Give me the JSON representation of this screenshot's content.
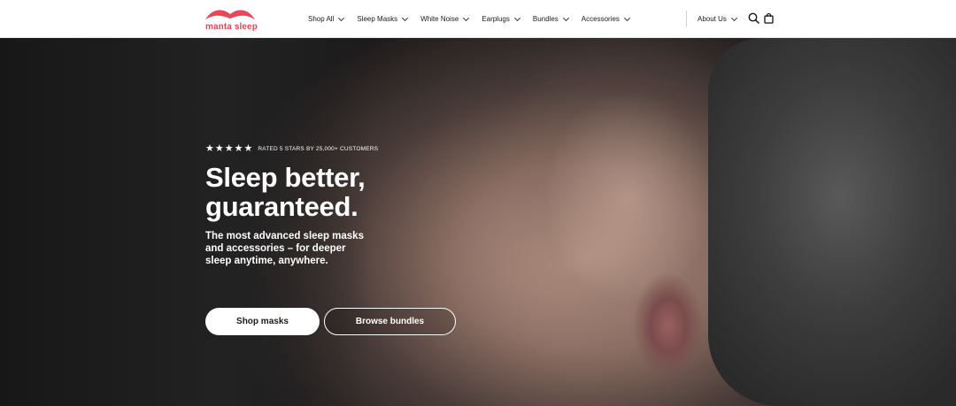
{
  "brand": {
    "name": "manta sleep",
    "color": "#e8465a"
  },
  "nav": {
    "items": [
      {
        "label": "Shop All"
      },
      {
        "label": "Sleep Masks"
      },
      {
        "label": "White Noise"
      },
      {
        "label": "Earplugs"
      },
      {
        "label": "Bundles"
      },
      {
        "label": "Accessories"
      }
    ],
    "about": "About Us"
  },
  "icons": {
    "search": "search-icon",
    "cart": "bag-icon"
  },
  "hero": {
    "rating_text": "RATED 5 STARS BY 25,000+ CUSTOMERS",
    "stars": 5,
    "headline_line1": "Sleep better,",
    "headline_line2": "guaranteed.",
    "subtext": "The most advanced sleep masks and accessories – for deeper sleep anytime, anywhere.",
    "primary_cta": "Shop masks",
    "secondary_cta": "Browse bundles"
  }
}
